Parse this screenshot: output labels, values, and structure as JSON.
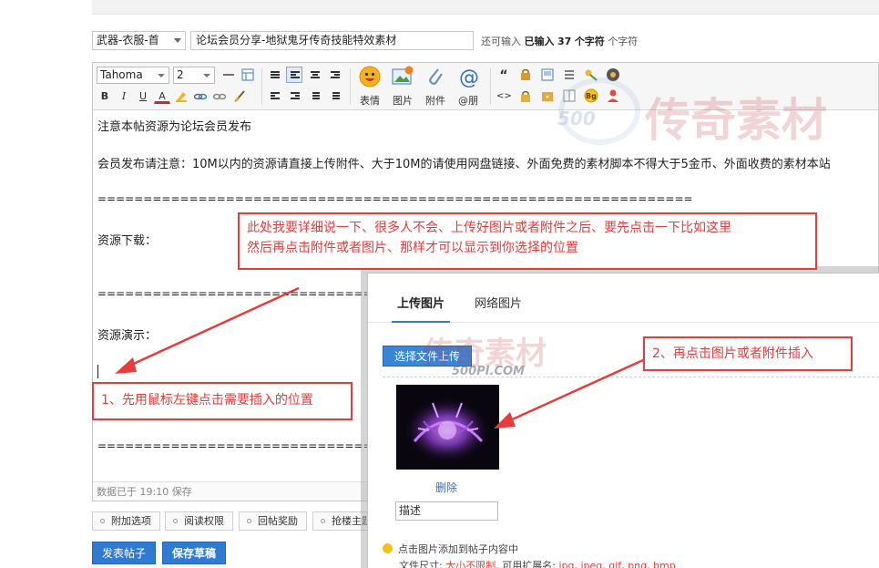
{
  "subject": {
    "category": "武器-衣服-首",
    "title": "论坛会员分享-地狱鬼牙传奇技能特效素材",
    "count_prefix": "还可输入",
    "count_done": "已输入",
    "count_num": "37",
    "count_unit": "个字符",
    "count_suffix": "个字符"
  },
  "toolbar": {
    "font_family": "Tahoma",
    "font_size": "2",
    "bold": "B",
    "italic": "I",
    "underline": "U",
    "color": "A",
    "emoji_label": "表情",
    "image_label": "图片",
    "attach_label": "附件",
    "at_label": "@朋",
    "quote_glyph": "“",
    "code_glyph": "<>",
    "bg_glyph": "Bg"
  },
  "editor": {
    "lines": [
      "注意本帖资源为论坛会员发布",
      "会员发布请注意：10M以内的资源请直接上传附件、大于10M的请使用网盘链接、外面免费的素材脚本不得大于5金币、外面收费的素材本站",
      "=================================================================",
      "资源下载：",
      "=================================================================",
      "资源演示：",
      "================================================================="
    ],
    "status": "数据已于 19:10 保存"
  },
  "options": [
    "附加选项",
    "阅读权限",
    "回帖奖励",
    "抢楼主题"
  ],
  "actions": {
    "post": "发表帖子",
    "draft": "保存草稿"
  },
  "annotations": {
    "top": [
      "此处我要详细说一下、很多人不会、上传好图片或者附件之后、要先点击一下比如这里",
      "然后再点击附件或者图片、那样才可以显示到你选择的位置"
    ],
    "step1": "1、先用鼠标左键点击需要插入的位置",
    "step2": "2、再点击图片或者附件插入"
  },
  "popup": {
    "tabs": [
      "上传图片",
      "网络图片"
    ],
    "upload_button": "选择文件上传",
    "delete": "删除",
    "desc_placeholder": "描述",
    "hint": "点击图片添加到帖子内容中",
    "size_label": "文件尺寸:",
    "size_value": "大小不限制",
    "ext_label": "可用扩展名:",
    "ext_value": "jpg, jpeg, gif, png, bmp"
  },
  "watermark": {
    "chars": "传奇素材",
    "url": "500PI.COM",
    "num": "500"
  },
  "colors": {
    "accent": "#2f7bd1",
    "annotation": "#e53c3c"
  }
}
